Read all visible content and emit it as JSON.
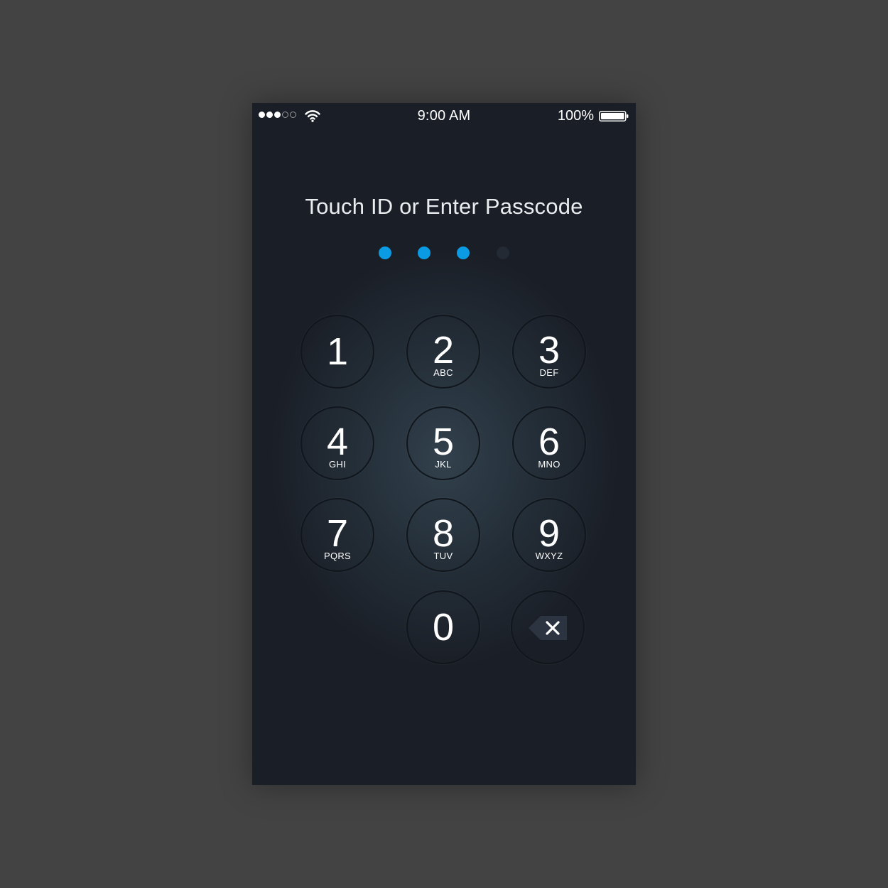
{
  "status_bar": {
    "signal": [
      true,
      true,
      true,
      false,
      false
    ],
    "time": "9:00 AM",
    "battery": "100%"
  },
  "prompt": "Touch ID or Enter Passcode",
  "passcode": {
    "filled": 3,
    "length": 4,
    "color": "#0b9be5"
  },
  "keypad": {
    "keys": [
      {
        "digit": "1",
        "letters": ""
      },
      {
        "digit": "2",
        "letters": "ABC"
      },
      {
        "digit": "3",
        "letters": "DEF"
      },
      {
        "digit": "4",
        "letters": "GHI"
      },
      {
        "digit": "5",
        "letters": "JKL"
      },
      {
        "digit": "6",
        "letters": "MNO"
      },
      {
        "digit": "7",
        "letters": "PQRS"
      },
      {
        "digit": "8",
        "letters": "TUV"
      },
      {
        "digit": "9",
        "letters": "WXYZ"
      },
      {
        "digit": "0",
        "letters": ""
      }
    ],
    "delete_icon": "backspace-icon"
  },
  "colors": {
    "page_background": "#434343",
    "screen_background": "#1a1e26",
    "text": "#ffffff"
  }
}
